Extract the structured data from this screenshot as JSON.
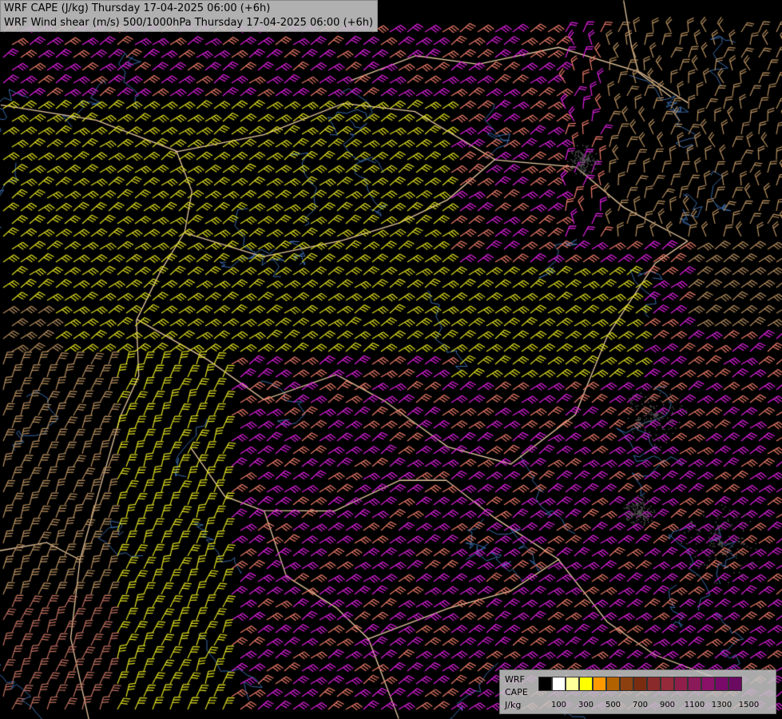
{
  "title": {
    "line1": "WRF CAPE (J/kg) Thursday 17-04-2025 06:00 (+6h)",
    "line2": "WRF Wind shear (m/s) 500/1000hPa Thursday 17-04-2025 06:00 (+6h)"
  },
  "legend": {
    "name": "WRF",
    "variable": "CAPE",
    "unit": "J/kg",
    "tick_labels": [
      "100",
      "300",
      "500",
      "700",
      "900",
      "1100",
      "1300",
      "1500"
    ],
    "colors": [
      "#000000",
      "#ffffff",
      "#ffff99",
      "#ffff00",
      "#ff9900",
      "#b36200",
      "#8c4010",
      "#7a2c10",
      "#8a2a2a",
      "#962a3a",
      "#8f1f4a",
      "#8a1a5a",
      "#8a1068",
      "#7a0a6a",
      "#6a0a60"
    ]
  },
  "layers": {
    "barb_colors": {
      "low": "#b89060",
      "moderate": "#e0e020",
      "strong": "#f07c6c",
      "very_strong": "#e020e0",
      "weak": "#c07060"
    },
    "border_color": "#e8c8a0",
    "river_color": "#3a6aa8"
  }
}
